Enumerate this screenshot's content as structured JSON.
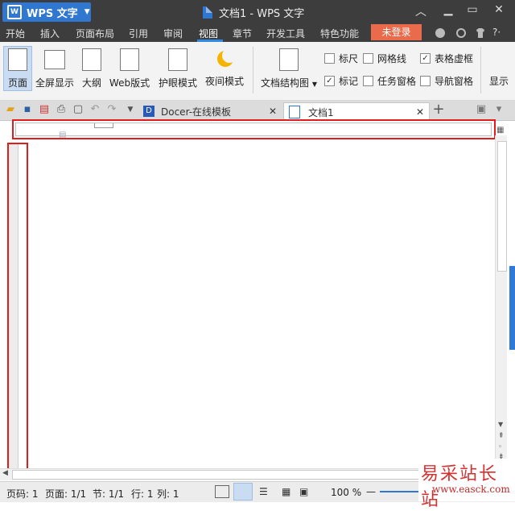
{
  "app": {
    "name": "WPS 文字",
    "window_title": "文档1 - WPS 文字"
  },
  "menu": [
    "开始",
    "插入",
    "页面布局",
    "引用",
    "审阅",
    "视图",
    "章节",
    "开发工具",
    "特色功能"
  ],
  "menu_active": "视图",
  "login_label": "未登录",
  "ribbon": {
    "buttons": [
      "页面",
      "全屏显示",
      "大纲",
      "Web版式",
      "护眼模式",
      "夜间模式",
      "文档结构图"
    ],
    "checks": [
      {
        "label": "标尺",
        "checked": false
      },
      {
        "label": "网格线",
        "checked": false
      },
      {
        "label": "表格虚框",
        "checked": true
      },
      {
        "label": "标记",
        "checked": true
      },
      {
        "label": "任务窗格",
        "checked": false
      },
      {
        "label": "导航窗格",
        "checked": false
      }
    ],
    "overflow_label": "显示"
  },
  "tabs": [
    {
      "title": "Docer-在线模板"
    },
    {
      "title": "文档1"
    }
  ],
  "status": {
    "page": "页码: 1",
    "pages": "页面: 1/1",
    "section": "节: 1/1",
    "row": "行: 1",
    "col": "列: 1",
    "zoom": "100 %"
  },
  "watermark": {
    "text": "易采站长站",
    "url": "www.easck.com"
  },
  "colors": {
    "accent": "#2f77d0",
    "login": "#ea6a4c",
    "highlight": "#e21b1b",
    "dark": "#3d3d3d"
  }
}
